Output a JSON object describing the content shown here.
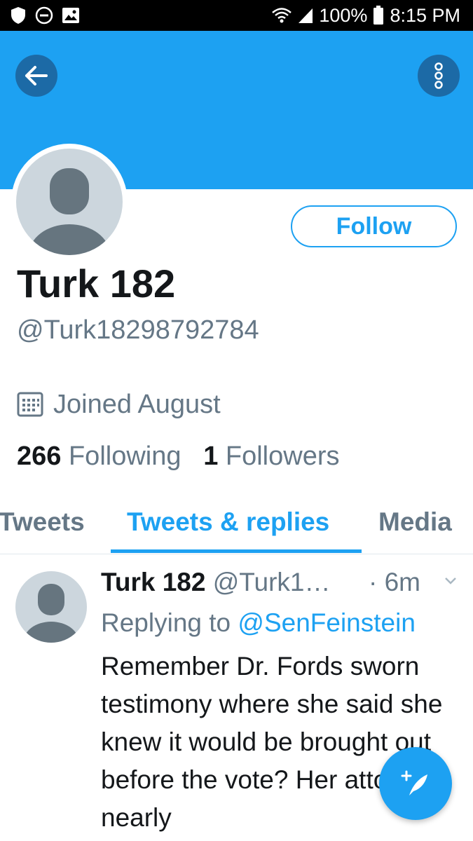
{
  "status_bar": {
    "battery": "100%",
    "time": "8:15 PM",
    "icons": [
      "shield-icon",
      "do-not-disturb-icon",
      "image-icon",
      "wifi-icon",
      "signal-icon",
      "battery-icon"
    ]
  },
  "header": {
    "banner_color": "#1da1f2",
    "back_icon": "back-arrow-icon",
    "more_icon": "more-vertical-icon"
  },
  "profile": {
    "follow_label": "Follow",
    "display_name": "Turk 182",
    "handle": "@Turk18298792784",
    "joined": "Joined August",
    "following_count": "266",
    "following_label": "Following",
    "followers_count": "1",
    "followers_label": "Followers"
  },
  "tabs": [
    {
      "label": "Tweets",
      "active": false
    },
    {
      "label": "Tweets & replies",
      "active": true
    },
    {
      "label": "Media",
      "active": false
    }
  ],
  "tweet": {
    "name": "Turk 182",
    "handle": "@Turk1…",
    "time": "· 6m",
    "replying_prefix": "Replying to",
    "replying_to": "@SenFeinstein",
    "text": "Remember Dr. Fords sworn testimony where she said she knew it would be brought out before the vote?  Her attorneys nearly"
  },
  "colors": {
    "accent": "#1da1f2",
    "secondary_text": "#657786",
    "primary_text": "#14171a"
  }
}
